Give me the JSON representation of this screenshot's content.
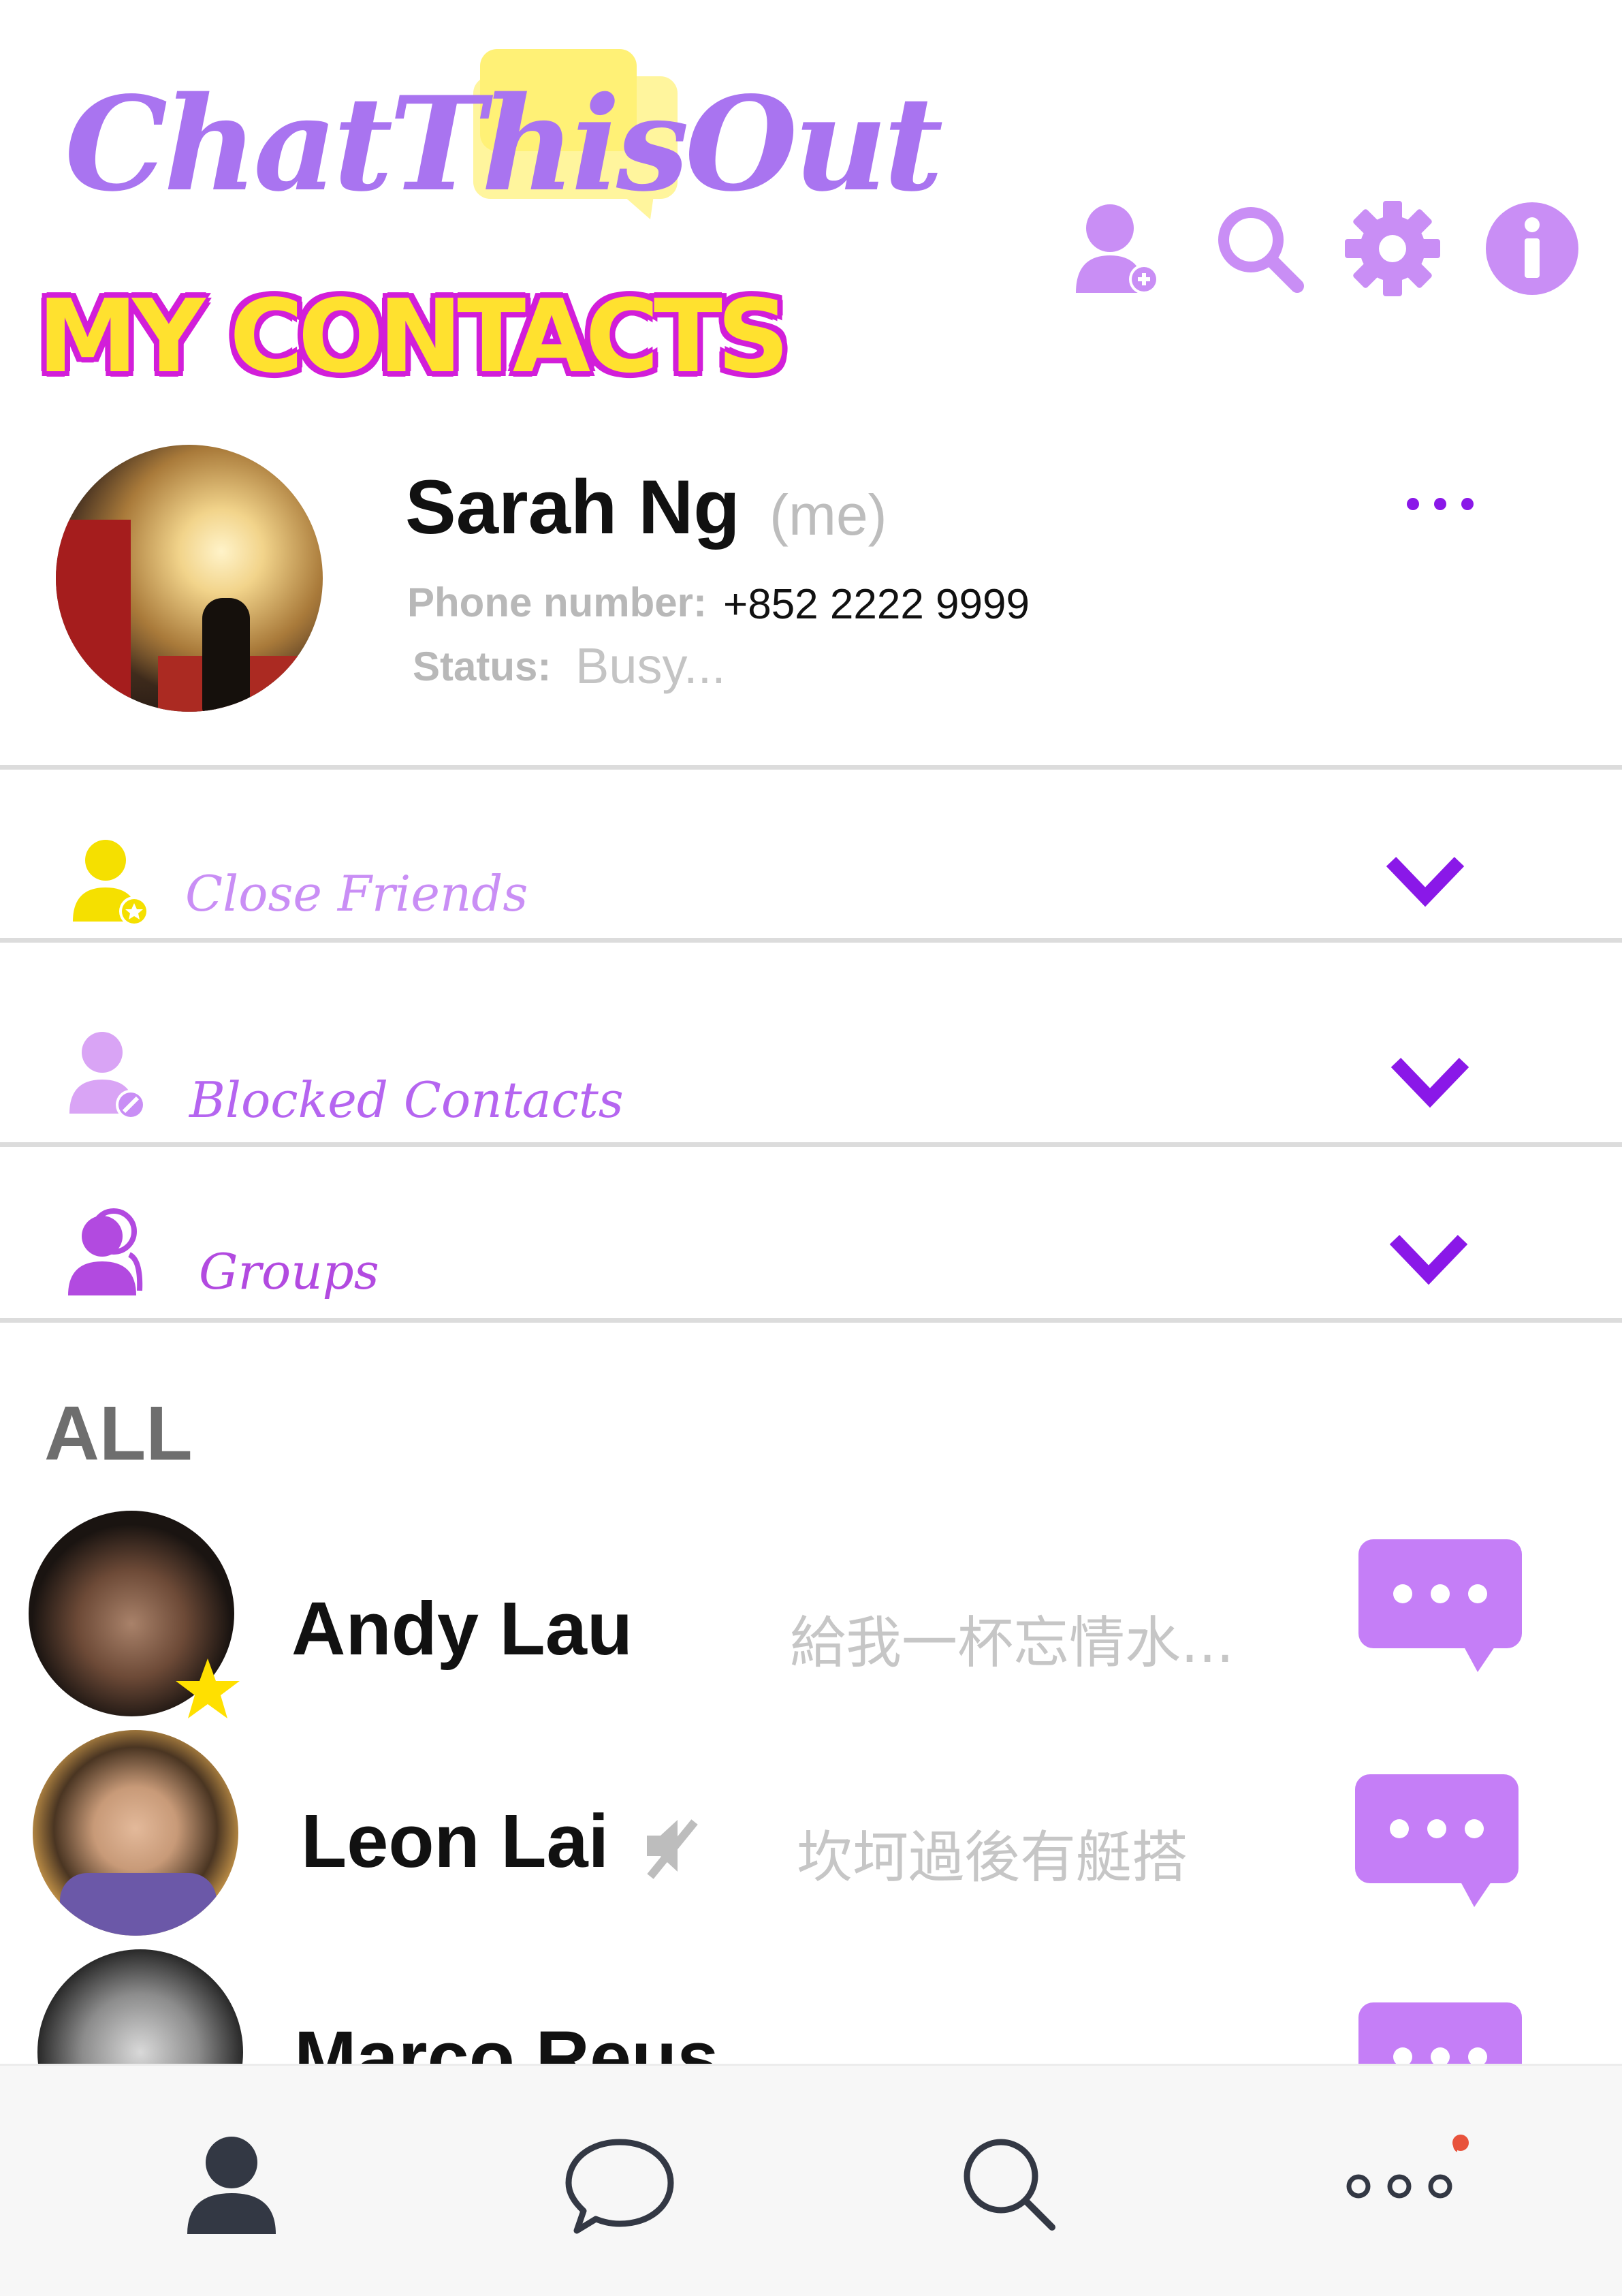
{
  "app": {
    "logo_text": "ChatThisOut"
  },
  "header": {
    "title": "MY CONTACTS",
    "icons": [
      "add-contact-icon",
      "search-icon",
      "gear-icon",
      "info-icon"
    ]
  },
  "me": {
    "name": "Sarah Ng",
    "tag": "(me)",
    "phone_label": "Phone number:",
    "phone": "+852 2222 9999",
    "status_label": "Status:",
    "status": "Busy..."
  },
  "groups": [
    {
      "label": "Close Friends",
      "color": "#f5e000",
      "icon": "star-person-icon"
    },
    {
      "label": "Blocked Contacts",
      "color": "#c98ef5",
      "icon": "blocked-person-icon"
    },
    {
      "label": "Groups",
      "color": "#b24ae0",
      "icon": "group-icon"
    }
  ],
  "all_heading": "ALL",
  "contacts": [
    {
      "name": "Andy Lau",
      "message": "給我一杯忘情水...",
      "favorite": true,
      "muted": false
    },
    {
      "name": "Leon Lai",
      "message": "坎坷過後有艇搭",
      "favorite": false,
      "muted": true
    },
    {
      "name": "Marco Reus",
      "message": "",
      "favorite": false,
      "muted": false
    }
  ],
  "colors": {
    "accent": "#c57ef7",
    "chevron": "#8a18e8",
    "logo_bubble": "#fff176",
    "title_fill": "#ffe12f",
    "title_outline": "#d21ed9"
  },
  "bottom_nav": [
    {
      "name": "contacts",
      "icon": "person-icon"
    },
    {
      "name": "chats",
      "icon": "chat-bubble-icon"
    },
    {
      "name": "search",
      "icon": "search-icon"
    },
    {
      "name": "more",
      "icon": "more-icon",
      "notification": true
    }
  ]
}
